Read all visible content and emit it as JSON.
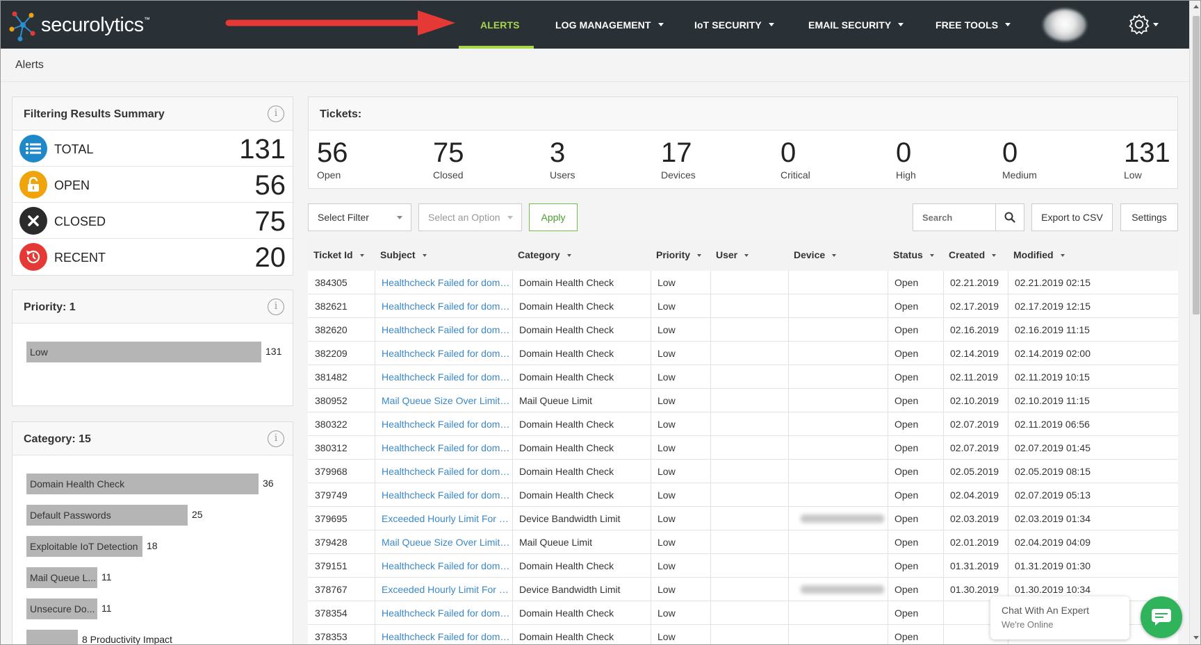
{
  "brand": {
    "name": "securolytics",
    "tm": "™"
  },
  "nav": {
    "items": [
      {
        "label": "ALERTS",
        "active": true
      },
      {
        "label": "LOG MANAGEMENT",
        "dropdown": true
      },
      {
        "label": "IoT SECURITY",
        "dropdown": true
      },
      {
        "label": "EMAIL SECURITY",
        "dropdown": true
      },
      {
        "label": "FREE TOOLS",
        "dropdown": true
      }
    ],
    "settings_icon": "gear-icon",
    "active_color": "#a6d64a",
    "bg_color": "#293136"
  },
  "breadcrumb": "Alerts",
  "summary": {
    "title": "Filtering Results Summary",
    "rows": [
      {
        "label": "TOTAL",
        "value": "131",
        "icon": "list-icon",
        "color": "#1e88c9"
      },
      {
        "label": "OPEN",
        "value": "56",
        "icon": "unlock-icon",
        "color": "#f0a30a"
      },
      {
        "label": "CLOSED",
        "value": "75",
        "icon": "x-icon",
        "color": "#2b2b2b"
      },
      {
        "label": "RECENT",
        "value": "20",
        "icon": "history-icon",
        "color": "#e53935"
      }
    ]
  },
  "priority": {
    "title": "Priority: 1",
    "max": 131,
    "bars": [
      {
        "label": "Low",
        "value": 131
      }
    ]
  },
  "category": {
    "title": "Category: 15",
    "max": 36,
    "bars": [
      {
        "label": "Domain Health Check",
        "value": 36,
        "count": "36"
      },
      {
        "label": "Default Passwords",
        "value": 25,
        "count": "25"
      },
      {
        "label": "Exploitable IoT Detection",
        "value": 18,
        "count": "18"
      },
      {
        "label": "Mail Queue L...",
        "value": 11,
        "count": "11"
      },
      {
        "label": "Unsecure Do...",
        "value": 11,
        "count": "11"
      },
      {
        "label": "",
        "value": 8,
        "count": "8  Productivity Impact"
      }
    ]
  },
  "tickets": {
    "title": "Tickets:",
    "kpis": [
      {
        "value": "56",
        "label": "Open"
      },
      {
        "value": "75",
        "label": "Closed"
      },
      {
        "value": "3",
        "label": "Users"
      },
      {
        "value": "17",
        "label": "Devices"
      },
      {
        "value": "0",
        "label": "Critical"
      },
      {
        "value": "0",
        "label": "High"
      },
      {
        "value": "0",
        "label": "Medium"
      },
      {
        "value": "131",
        "label": "Low"
      }
    ]
  },
  "filters": {
    "select_filter": "Select Filter",
    "select_option": "Select an Option",
    "apply": "Apply",
    "search_placeholder": "Search",
    "export": "Export to CSV",
    "settings": "Settings"
  },
  "table": {
    "columns": [
      "Ticket Id",
      "Subject",
      "Category",
      "Priority",
      "User",
      "Device",
      "Status",
      "Created",
      "Modified"
    ],
    "rows": [
      [
        "384305",
        "Healthcheck Failed for domai...",
        "Domain Health Check",
        "Low",
        "",
        "",
        "Open",
        "02.21.2019",
        "02.21.2019 02:15"
      ],
      [
        "382621",
        "Healthcheck Failed for domai...",
        "Domain Health Check",
        "Low",
        "",
        "",
        "Open",
        "02.17.2019",
        "02.17.2019 12:15"
      ],
      [
        "382620",
        "Healthcheck Failed for domai...",
        "Domain Health Check",
        "Low",
        "",
        "",
        "Open",
        "02.16.2019",
        "02.16.2019 11:15"
      ],
      [
        "382209",
        "Healthcheck Failed for domai...",
        "Domain Health Check",
        "Low",
        "",
        "",
        "Open",
        "02.14.2019",
        "02.14.2019 02:00"
      ],
      [
        "381482",
        "Healthcheck Failed for domai...",
        "Domain Health Check",
        "Low",
        "",
        "",
        "Open",
        "02.11.2019",
        "02.11.2019 10:15"
      ],
      [
        "380952",
        "Mail Queue Size Over Limit for...",
        "Mail Queue Limit",
        "Low",
        "",
        "",
        "Open",
        "02.10.2019",
        "02.10.2019 11:15"
      ],
      [
        "380322",
        "Healthcheck Failed for domai...",
        "Domain Health Check",
        "Low",
        "",
        "",
        "Open",
        "02.07.2019",
        "02.11.2019 06:56"
      ],
      [
        "380312",
        "Healthcheck Failed for domai...",
        "Domain Health Check",
        "Low",
        "",
        "",
        "Open",
        "02.07.2019",
        "02.07.2019 01:45"
      ],
      [
        "379968",
        "Healthcheck Failed for domai...",
        "Domain Health Check",
        "Low",
        "",
        "",
        "Open",
        "02.05.2019",
        "02.05.2019 08:15"
      ],
      [
        "379749",
        "Healthcheck Failed for domai...",
        "Domain Health Check",
        "Low",
        "",
        "",
        "Open",
        "02.04.2019",
        "02.07.2019 05:13"
      ],
      [
        "379695",
        "Exceeded Hourly Limit For Ba...",
        "Device Bandwidth Limit",
        "Low",
        "",
        "blurred",
        "Open",
        "02.03.2019",
        "02.03.2019 01:34"
      ],
      [
        "379428",
        "Mail Queue Size Over Limit for...",
        "Mail Queue Limit",
        "Low",
        "",
        "",
        "Open",
        "02.01.2019",
        "02.04.2019 04:09"
      ],
      [
        "379151",
        "Healthcheck Failed for domai...",
        "Domain Health Check",
        "Low",
        "",
        "",
        "Open",
        "01.31.2019",
        "01.31.2019 01:30"
      ],
      [
        "378767",
        "Exceeded Hourly Limit For Ba...",
        "Device Bandwidth Limit",
        "Low",
        "",
        "blurred",
        "Open",
        "01.30.2019",
        "01.30.2019 10:34"
      ],
      [
        "378354",
        "Healthcheck Failed for domai...",
        "Domain Health Check",
        "Low",
        "",
        "",
        "Open",
        "",
        ""
      ],
      [
        "378353",
        "Healthcheck Failed for domai...",
        "Domain Health Check",
        "Low",
        "",
        "",
        "Open",
        "",
        ""
      ]
    ]
  },
  "chat": {
    "title": "Chat With An Expert",
    "subtitle": "We're Online"
  }
}
